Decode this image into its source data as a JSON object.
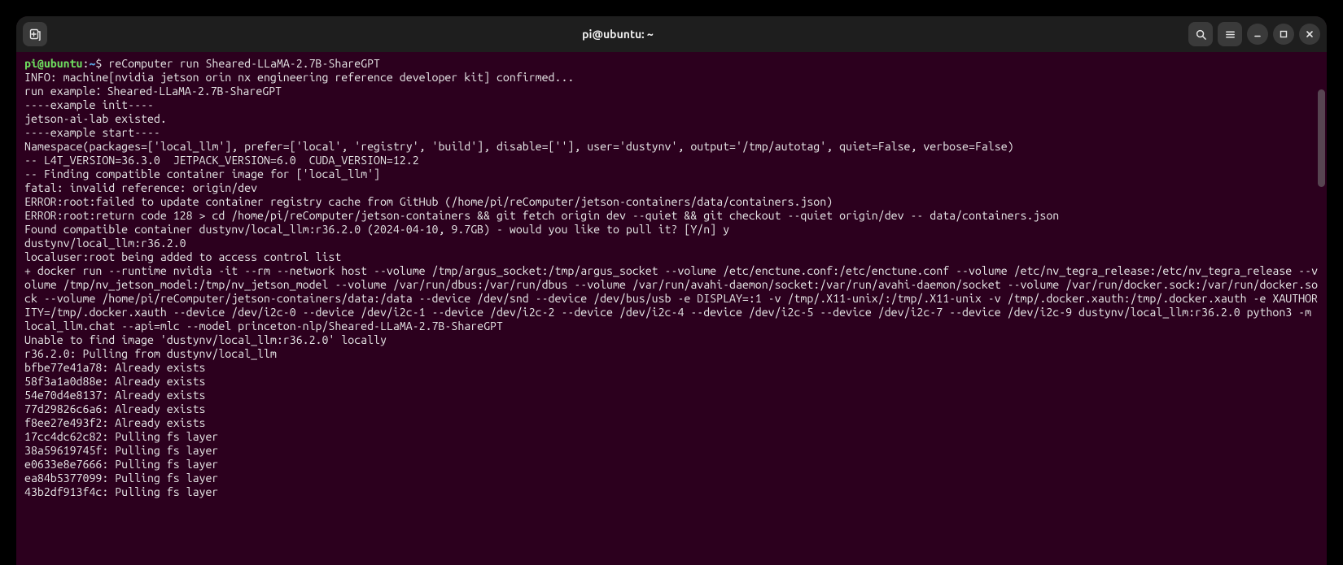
{
  "titlebar": {
    "title": "pi@ubuntu: ~"
  },
  "prompt": {
    "user_host": "pi@ubuntu",
    "path": "~",
    "command": "reComputer run Sheared-LLaMA-2.7B-ShareGPT"
  },
  "lines": [
    "INFO: machine[nvidia jetson orin nx engineering reference developer kit] confirmed...",
    "run example：Sheared-LLaMA-2.7B-ShareGPT",
    "----example init----",
    "jetson-ai-lab existed.",
    "----example start----",
    "Namespace(packages=['local_llm'], prefer=['local', 'registry', 'build'], disable=[''], user='dustynv', output='/tmp/autotag', quiet=False, verbose=False)",
    "-- L4T_VERSION=36.3.0  JETPACK_VERSION=6.0  CUDA_VERSION=12.2",
    "-- Finding compatible container image for ['local_llm']",
    "fatal: invalid reference: origin/dev",
    "ERROR:root:failed to update container registry cache from GitHub (/home/pi/reComputer/jetson-containers/data/containers.json)",
    "ERROR:root:return code 128 > cd /home/pi/reComputer/jetson-containers && git fetch origin dev --quiet && git checkout --quiet origin/dev -- data/containers.json",
    "",
    "Found compatible container dustynv/local_llm:r36.2.0 (2024-04-10, 9.7GB) - would you like to pull it? [Y/n] y",
    "dustynv/local_llm:r36.2.0",
    "localuser:root being added to access control list",
    "+ docker run --runtime nvidia -it --rm --network host --volume /tmp/argus_socket:/tmp/argus_socket --volume /etc/enctune.conf:/etc/enctune.conf --volume /etc/nv_tegra_release:/etc/nv_tegra_release --volume /tmp/nv_jetson_model:/tmp/nv_jetson_model --volume /var/run/dbus:/var/run/dbus --volume /var/run/avahi-daemon/socket:/var/run/avahi-daemon/socket --volume /var/run/docker.sock:/var/run/docker.sock --volume /home/pi/reComputer/jetson-containers/data:/data --device /dev/snd --device /dev/bus/usb -e DISPLAY=:1 -v /tmp/.X11-unix/:/tmp/.X11-unix -v /tmp/.docker.xauth:/tmp/.docker.xauth -e XAUTHORITY=/tmp/.docker.xauth --device /dev/i2c-0 --device /dev/i2c-1 --device /dev/i2c-2 --device /dev/i2c-4 --device /dev/i2c-5 --device /dev/i2c-7 --device /dev/i2c-9 dustynv/local_llm:r36.2.0 python3 -m local_llm.chat --api=mlc --model princeton-nlp/Sheared-LLaMA-2.7B-ShareGPT",
    "Unable to find image 'dustynv/local_llm:r36.2.0' locally",
    "r36.2.0: Pulling from dustynv/local_llm",
    "bfbe77e41a78: Already exists",
    "58f3a1a0d88e: Already exists",
    "54e70d4e8137: Already exists",
    "77d29826c6a6: Already exists",
    "f8ee27e493f2: Already exists",
    "17cc4dc62c82: Pulling fs layer",
    "38a59619745f: Pulling fs layer",
    "e0633e8e7666: Pulling fs layer",
    "ea84b5377099: Pulling fs layer",
    "43b2df913f4c: Pulling fs layer"
  ]
}
